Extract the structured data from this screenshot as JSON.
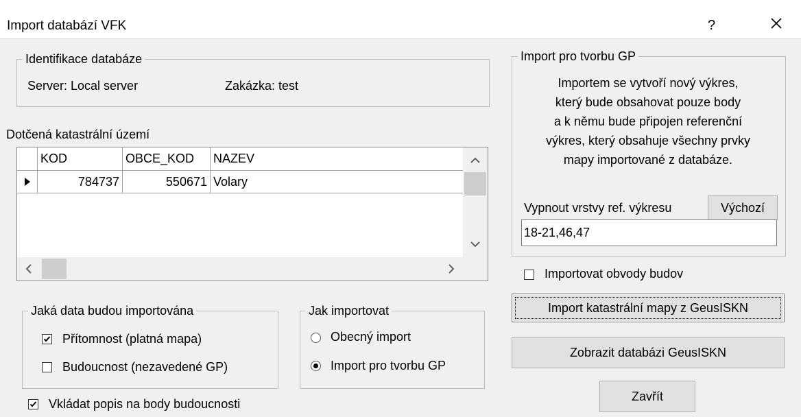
{
  "window": {
    "title": "Import databází VFK",
    "help": "?"
  },
  "ident": {
    "legend": "Identifikace databáze",
    "server": "Server: Local server",
    "zakazka": "Zakázka: test"
  },
  "table": {
    "caption": "Dotčená katastrální území",
    "columns": [
      "KOD",
      "OBCE_KOD",
      "NAZEV"
    ],
    "rows": [
      {
        "kod": "784737",
        "obce_kod": "550671",
        "nazev": "Volary"
      }
    ]
  },
  "import_data": {
    "legend": "Jaká data budou importována",
    "present": {
      "label": "Přítomnost (platná mapa)",
      "checked": true
    },
    "future": {
      "label": "Budoucnost (nezavedené GP)",
      "checked": false
    }
  },
  "how": {
    "legend": "Jak importovat",
    "general": {
      "label": "Obecný import",
      "selected": false
    },
    "gp": {
      "label": "Import pro tvorbu GP",
      "selected": true
    }
  },
  "insert_desc": {
    "label": "Vkládat popis na body budoucnosti",
    "checked": true
  },
  "gp_group": {
    "legend": "Import pro tvorbu GP",
    "lines": [
      "Importem se vytvoří  nový výkres,",
      "který bude obsahovat pouze body",
      "a k němu bude připojen referenční",
      "výkres, který obsahuje všechny prvky",
      "mapy importované z databáze."
    ],
    "layers_label": "Vypnout vrstvy ref. výkresu",
    "default_button": "Výchozí",
    "layers_value": "18-21,46,47"
  },
  "outlines": {
    "label": "Importovat obvody budov",
    "checked": false
  },
  "buttons": {
    "import_map": "Import katastrální mapy z GeusISKN",
    "show_db": "Zobrazit databázi GeusISKN",
    "close": "Zavřít"
  },
  "colors": {
    "accent": "#000000",
    "window_bg": "#f0f0f0"
  }
}
